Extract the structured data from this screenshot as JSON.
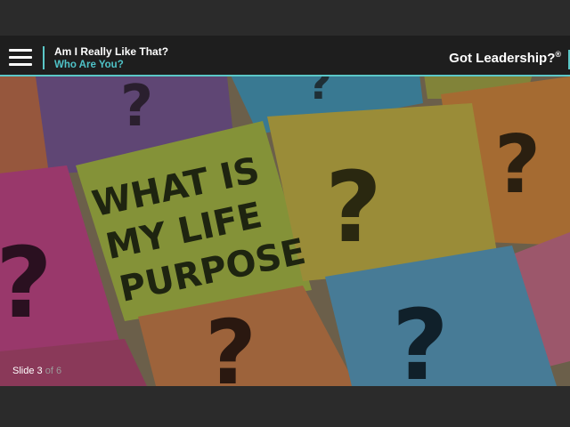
{
  "header": {
    "title": "Am I Really Like That?",
    "subtitle": "Who Are You?",
    "brand": "Got Leadership?",
    "brand_mark": "®"
  },
  "slide": {
    "label": "Slide",
    "current": "3",
    "of_label": "of",
    "total": "6",
    "image_note_lines": [
      "WHAT IS",
      "MY LIFE",
      "PURPOSE"
    ],
    "question_mark": "?"
  },
  "colors": {
    "accent": "#5bc8c8",
    "subtitle": "#4fc3c8",
    "header_bg": "#1e1e1e"
  }
}
